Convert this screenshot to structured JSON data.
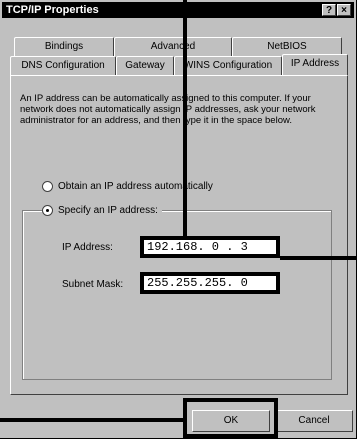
{
  "window": {
    "title": "TCP/IP Properties",
    "help_glyph": "?",
    "close_glyph": "×"
  },
  "tabs_row1": [
    {
      "label": "Bindings"
    },
    {
      "label": "Advanced"
    },
    {
      "label": "NetBIOS"
    }
  ],
  "tabs_row2": [
    {
      "label": "DNS Configuration"
    },
    {
      "label": "Gateway"
    },
    {
      "label": "WINS Configuration"
    },
    {
      "label": "IP Address"
    }
  ],
  "active_tab": "IP Address",
  "description": "An IP address can be automatically assigned to this computer. If your network does not automatically assign IP addresses, ask your network administrator for an address, and then type it in the space below.",
  "options": {
    "obtain": {
      "label": "Obtain an IP address automatically",
      "selected": false
    },
    "specify": {
      "label": "Specify an IP address:",
      "selected": true
    }
  },
  "ip_address": {
    "label": "IP Address:",
    "value": "192.168. 0 . 3"
  },
  "subnet_mask": {
    "label": "Subnet Mask:",
    "value": "255.255.255. 0"
  },
  "buttons": {
    "ok": "OK",
    "cancel": "Cancel"
  }
}
